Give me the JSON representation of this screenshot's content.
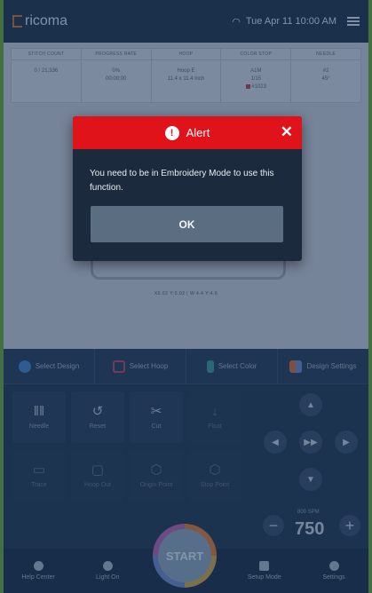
{
  "header": {
    "logo": "ricoma",
    "datetime": "Tue Apr 11  10:00 AM"
  },
  "stats": {
    "columns": [
      "STITCH COUNT",
      "PROGRESS RATE",
      "HOOP",
      "COLOR STOP",
      "NEEDLE"
    ],
    "stitch_count": "0 / 21,336",
    "progress": [
      "0%",
      "00:00:00"
    ],
    "hoop": [
      "Hoop E",
      "11.4 x 11.4 inch"
    ],
    "color_stop": [
      "A1M",
      "1/15",
      "#1023"
    ],
    "needle": [
      "#2",
      "45°"
    ]
  },
  "coords": "X0.02 Y:0.02 | W:4.4 Y:4.6",
  "toolbar": {
    "select_design": "Select Design",
    "select_hoop": "Select Hoop",
    "select_color": "Select Color",
    "design_settings": "Design Settings"
  },
  "controls": {
    "needle": "Needle",
    "reset": "Reset",
    "cut": "Cut",
    "float": "Float",
    "trace": "Trace",
    "hoop_out": "Hoop Out",
    "origin_point": "Origin Point",
    "stop_point": "Stop Point"
  },
  "speed": {
    "label": "800 SPM",
    "value": "750"
  },
  "start_label": "START",
  "bottombar": {
    "help_center": "Help Center",
    "light_on": "Light On",
    "setup_mode": "Setup Mode",
    "settings": "Settings"
  },
  "modal": {
    "title": "Alert",
    "message": "You need to be in Embroidery Mode to use this function.",
    "ok_label": "OK"
  },
  "colors": {
    "alert_red": "#e0131b",
    "modal_bg": "#1b2b3d",
    "ok_button": "#5b6d80"
  }
}
